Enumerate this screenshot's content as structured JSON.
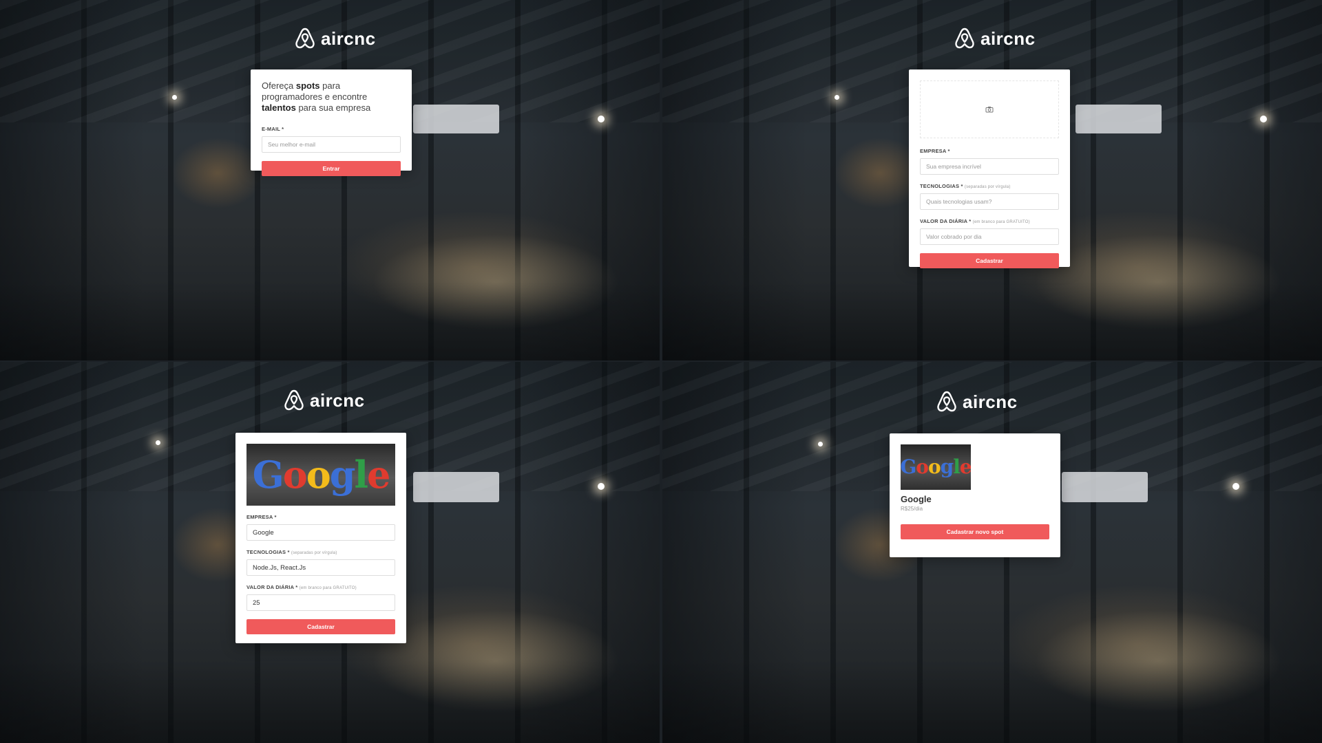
{
  "brand": {
    "name": "aircnc",
    "accent": "#f05a5b"
  },
  "login": {
    "intro_prefix": "Ofereça ",
    "intro_bold1": "spots",
    "intro_mid": " para programadores e encontre ",
    "intro_bold2": "talentos",
    "intro_suffix": " para sua empresa",
    "email_label": "E-MAIL *",
    "email_placeholder": "Seu melhor e-mail",
    "submit_label": "Entrar"
  },
  "new_spot_empty": {
    "thumbnail_icon": "camera-icon",
    "company_label": "EMPRESA *",
    "company_placeholder": "Sua empresa incrível",
    "techs_label": "TECNOLOGIAS *",
    "techs_hint": "(separadas por vírgula)",
    "techs_placeholder": "Quais tecnologias usam?",
    "price_label": "VALOR DA DIÁRIA *",
    "price_hint": "(em branco para GRATUITO)",
    "price_placeholder": "Valor cobrado por dia",
    "submit_label": "Cadastrar"
  },
  "new_spot_filled": {
    "thumbnail_text": "Google",
    "company_label": "EMPRESA *",
    "company_value": "Google",
    "techs_label": "TECNOLOGIAS *",
    "techs_hint": "(separadas por vírgula)",
    "techs_value": "Node.Js, React.Js",
    "price_label": "VALOR DA DIÁRIA *",
    "price_hint": "(em branco para GRATUITO)",
    "price_value": "25",
    "submit_label": "Cadastrar"
  },
  "dashboard": {
    "spot_thumbnail_text": "Google",
    "spot_name": "Google",
    "spot_price": "R$25/dia",
    "new_spot_label": "Cadastrar novo spot"
  }
}
